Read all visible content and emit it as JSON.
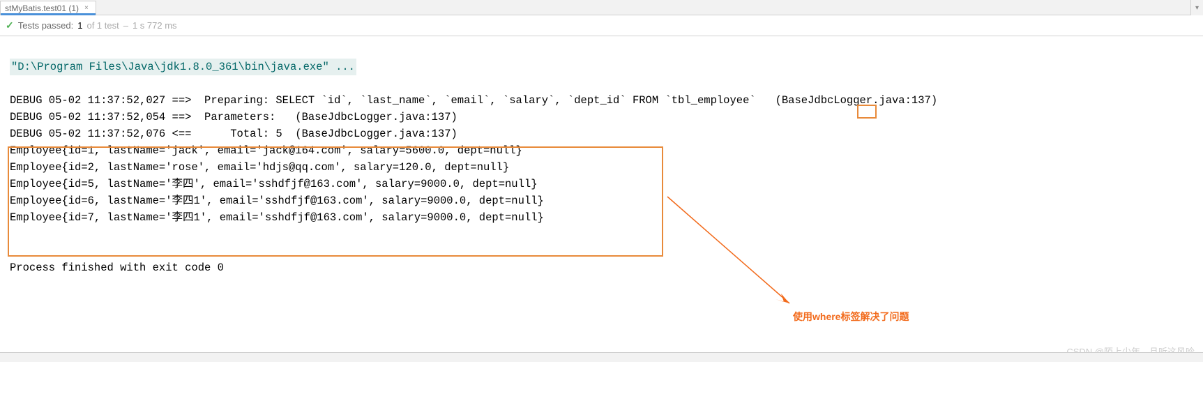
{
  "tab": {
    "label": "stMyBatis.test01 (1)",
    "close": "×"
  },
  "status": {
    "check": "✓",
    "label": "Tests passed:",
    "count": "1",
    "of_tests": "of 1 test",
    "dash": "–",
    "time": "1 s 772 ms"
  },
  "console": {
    "path": "\"D:\\Program Files\\Java\\jdk1.8.0_361\\bin\\java.exe\" ...",
    "blank1": "",
    "debug1": "DEBUG 05-02 11:37:52,027 ==>  Preparing: SELECT `id`, `last_name`, `email`, `salary`, `dept_id` FROM `tbl_employee`   (BaseJdbcLogger.java:137)",
    "debug2": "DEBUG 05-02 11:37:52,054 ==>  Parameters:   (BaseJdbcLogger.java:137)",
    "debug3": "DEBUG 05-02 11:37:52,076 <==      Total: 5  (BaseJdbcLogger.java:137)",
    "emp1": "Employee{id=1, lastName='jack', email='jack@164.com', salary=5600.0, dept=null}",
    "emp2": "Employee{id=2, lastName='rose', email='hdjs@qq.com', salary=120.0, dept=null}",
    "emp3": "Employee{id=5, lastName='李四', email='sshdfjf@163.com', salary=9000.0, dept=null}",
    "emp4": "Employee{id=6, lastName='李四1', email='sshdfjf@163.com', salary=9000.0, dept=null}",
    "emp5": "Employee{id=7, lastName='李四1', email='sshdfjf@163.com', salary=9000.0, dept=null}",
    "blank2": "",
    "blank3": "",
    "exit": "Process finished with exit code 0"
  },
  "annotation": {
    "text": "使用where标签解决了问题"
  },
  "watermark": "CSDN @陌上少年，且听这风吟",
  "gutter": "▾"
}
